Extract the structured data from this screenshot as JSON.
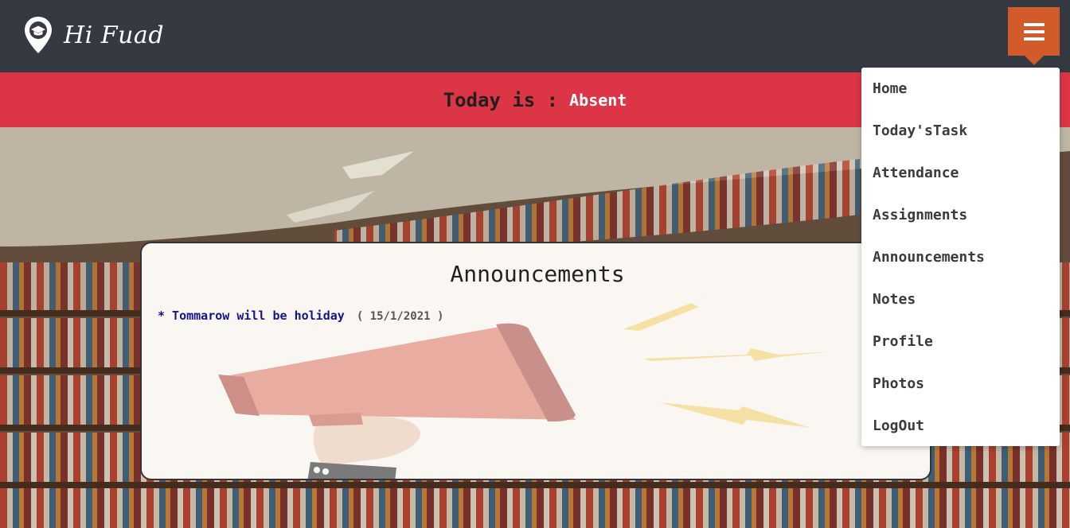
{
  "navbar": {
    "brand": "Hi Fuad",
    "logo_icon": "graduation-cap-pin-icon",
    "menu_icon": "hamburger-icon",
    "colors": {
      "navbar": "#353a42",
      "menu_button": "#d15b2b"
    }
  },
  "banner": {
    "label": "Today is :",
    "value": "Absent",
    "color": "#dc3545"
  },
  "announcements": {
    "title": "Announcements",
    "items": [
      {
        "text": "* Tommarow will be holiday",
        "date": "( 15/1/2021 )"
      }
    ],
    "illustration": "megaphone-illustration"
  },
  "menu": {
    "items": [
      {
        "label": "Home"
      },
      {
        "label": "Today'sTask"
      },
      {
        "label": "Attendance"
      },
      {
        "label": "Assignments"
      },
      {
        "label": "Announcements"
      },
      {
        "label": "Notes"
      },
      {
        "label": "Profile"
      },
      {
        "label": "Photos"
      },
      {
        "label": "LogOut"
      }
    ]
  }
}
